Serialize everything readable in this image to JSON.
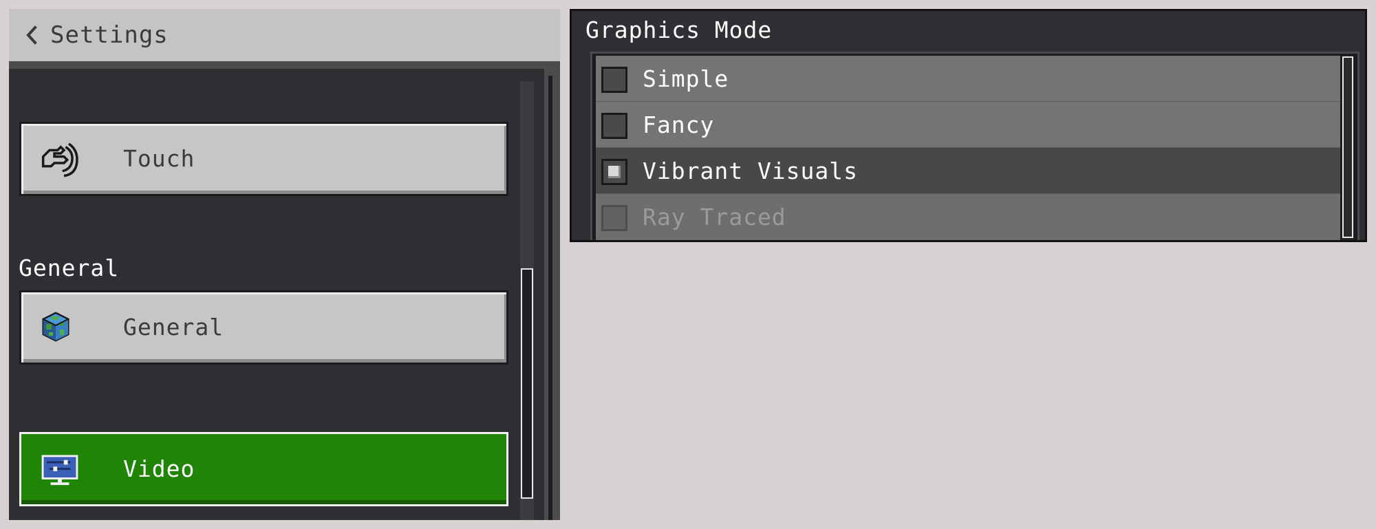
{
  "header": {
    "back_label": "Settings",
    "back_icon": "chevron-left-icon"
  },
  "sidebar": {
    "items": [
      {
        "label": "Touch",
        "icon": "touch-hand-icon",
        "selected": false
      },
      {
        "label": "General",
        "icon": "globe-cube-icon",
        "selected": false
      },
      {
        "label": "Video",
        "icon": "monitor-icon",
        "selected": true
      }
    ],
    "section_general_label": "General"
  },
  "graphics_mode": {
    "title": "Graphics Mode",
    "options": [
      {
        "label": "Simple",
        "checked": false,
        "enabled": true
      },
      {
        "label": "Fancy",
        "checked": false,
        "enabled": true
      },
      {
        "label": "Vibrant Visuals",
        "checked": true,
        "enabled": true
      },
      {
        "label": "Ray Traced",
        "checked": false,
        "enabled": false
      }
    ]
  },
  "colors": {
    "page_background": "#d8d2d3",
    "panel_dark": "#2e2f33",
    "button_gray": "#c6c6c6",
    "selected_green": "#208407"
  }
}
